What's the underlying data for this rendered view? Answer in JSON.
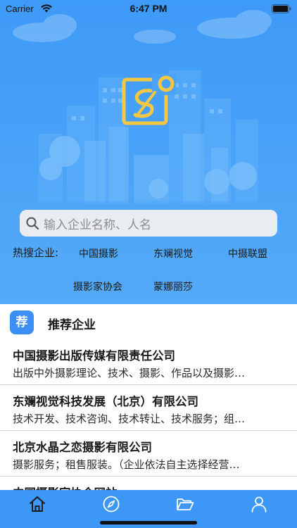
{
  "status_bar": {
    "carrier": "Carrier",
    "time": "6:47 PM"
  },
  "search": {
    "placeholder": "输入企业名称、人名"
  },
  "hot_search": {
    "label": "热搜企业:",
    "tags": [
      "中国摄影",
      "东斓视觉",
      "中摄联盟",
      "摄影家协会",
      "蒙娜丽莎"
    ]
  },
  "recommend": {
    "badge": "荐",
    "title": "推荐企业"
  },
  "companies": [
    {
      "name": "中国摄影出版传媒有限责任公司",
      "desc": "出版中外摄影理论、技术、摄影、作品以及摄影…"
    },
    {
      "name": "东斓视觉科技发展（北京）有限公司",
      "desc": "技术开发、技术咨询、技术转让、技术服务；组…"
    },
    {
      "name": "北京水晶之恋摄影有限公司",
      "desc": "摄影服务；租售服装。（企业依法自主选择经营…"
    },
    {
      "name": "中国摄影家协会网站"
    }
  ],
  "tab_bar": {
    "tabs": [
      "home-icon",
      "compass-icon",
      "folder-icon",
      "user-icon"
    ]
  },
  "colors": {
    "primary": "#3c97f6",
    "logo_yellow": "#f6c741"
  }
}
